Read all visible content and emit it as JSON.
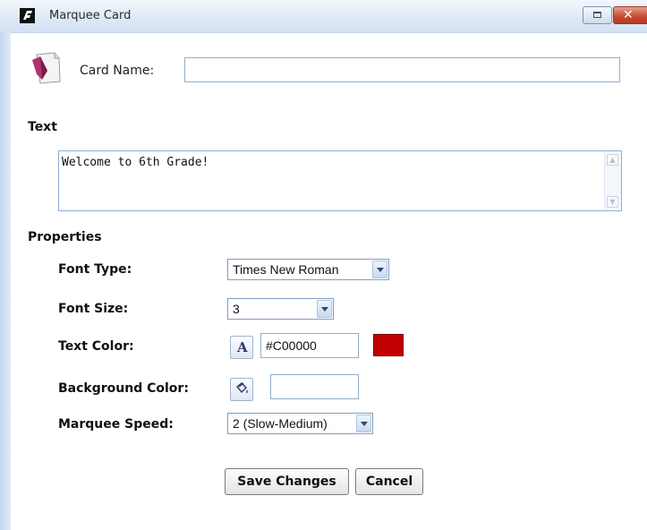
{
  "window": {
    "title": "Marquee Card"
  },
  "card": {
    "name_label": "Card Name:",
    "name_value": ""
  },
  "text_section": {
    "heading": "Text",
    "content": "Welcome to 6th Grade!"
  },
  "properties": {
    "heading": "Properties",
    "font_type": {
      "label": "Font Type:",
      "value": "Times New Roman"
    },
    "font_size": {
      "label": "Font Size:",
      "value": "3"
    },
    "text_color": {
      "label": "Text Color:",
      "value": "#C00000",
      "swatch": "#C00000",
      "button_glyph": "A"
    },
    "background_color": {
      "label": "Background Color:",
      "value": ""
    },
    "marquee_speed": {
      "label": "Marquee Speed:",
      "value": "2 (Slow-Medium)"
    }
  },
  "actions": {
    "save_label": "Save Changes",
    "cancel_label": "Cancel"
  },
  "icons": [
    "app-logo-icon",
    "restore-icon",
    "close-icon",
    "card-icon",
    "scroll-up-icon",
    "scroll-down-icon",
    "paint-bucket-icon"
  ],
  "colors": {
    "titlebar": "#dfe9f6",
    "input_border": "#8faed1",
    "close": "#c5472d"
  }
}
